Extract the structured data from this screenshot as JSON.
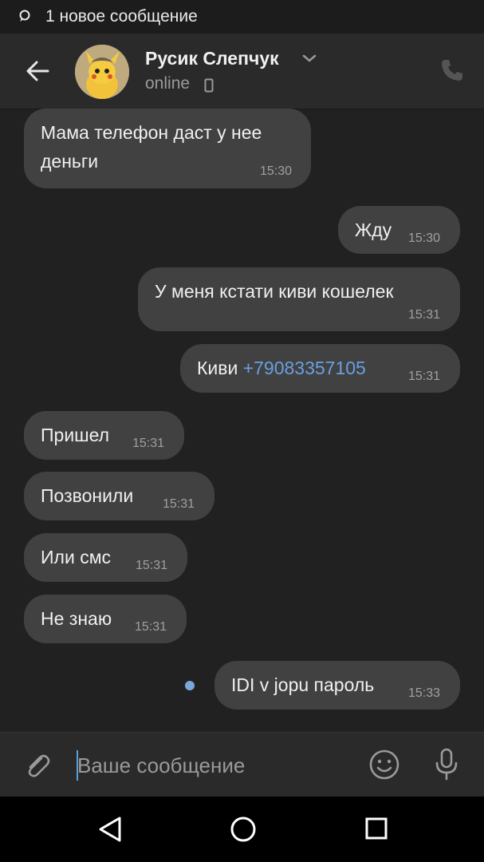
{
  "status_bar": {
    "notification": "1 новое сообщение"
  },
  "header": {
    "contact_name": "Русик Слепчук",
    "status": "online"
  },
  "messages": [
    {
      "direction": "in",
      "line1": "Мама телефон даст у нее",
      "line2": "деньги",
      "time": "15:30"
    },
    {
      "direction": "out",
      "text": "Жду",
      "time": "15:30"
    },
    {
      "direction": "out",
      "text": "У меня кстати киви кошелек",
      "time": "15:31"
    },
    {
      "direction": "out",
      "text": "Киви ",
      "link": "+79083357105",
      "time": "15:31"
    },
    {
      "direction": "in",
      "text": "Пришел",
      "time": "15:31"
    },
    {
      "direction": "in",
      "text": "Позвонили",
      "time": "15:31"
    },
    {
      "direction": "in",
      "text": "Или смс",
      "time": "15:31"
    },
    {
      "direction": "in",
      "text": "Не знаю",
      "time": "15:31"
    },
    {
      "direction": "out",
      "text": "IDI v jopu пароль",
      "time": "15:33",
      "unread": true
    }
  ],
  "composer": {
    "placeholder": "Ваше сообщение",
    "value": ""
  },
  "icons": {
    "status": "chat-bubble-icon",
    "back": "arrow-left-icon",
    "dropdown": "chevron-down-icon",
    "device": "smartphone-icon",
    "call": "phone-icon",
    "attach": "paperclip-icon",
    "emoji": "smiley-icon",
    "mic": "microphone-icon",
    "nav_back": "triangle-back-icon",
    "nav_home": "circle-home-icon",
    "nav_recent": "square-recents-icon"
  },
  "colors": {
    "background": "#212121",
    "bubble": "#414141",
    "link": "#6a9fe0",
    "unread_dot": "#7aa7db"
  }
}
